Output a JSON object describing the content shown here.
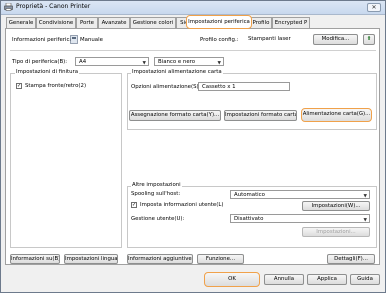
{
  "window": {
    "title": "Proprietà - Canon Printer",
    "close_glyph": "✕"
  },
  "tabs": [
    {
      "label": "Generale"
    },
    {
      "label": "Condivisione"
    },
    {
      "label": "Porte"
    },
    {
      "label": "Avanzate"
    },
    {
      "label": "Gestione colori"
    },
    {
      "label": "Sicurezza"
    },
    {
      "label": "Impostazioni periferica"
    },
    {
      "label": "Profilo"
    },
    {
      "label": "Encrypted P"
    }
  ],
  "device_info": {
    "label": "Informazioni periferica:",
    "value": "Manuale",
    "profile_label": "Profilo config.:",
    "profile_value": "Stampanti laser",
    "modify_button": "Modifica..."
  },
  "paper": {
    "type_label": "Tipo di periferica(B):",
    "size_value": "A4",
    "color_value": "Bianco e nero"
  },
  "finishing": {
    "title": "Impostazioni di finitura",
    "duplex_label": "Stampa fronte/retro(2)",
    "duplex_checked": true
  },
  "paper_source": {
    "title": "Impostazioni alimentazione carta",
    "options_label": "Opzioni alimentazione(S):",
    "options_value": "Cassetto x 1",
    "btn_assign": "Assegnazione formato carta(Y)...",
    "btn_format": "Impostazioni formato carta(K)...",
    "btn_feed": "Alimentazione carta(G)..."
  },
  "other": {
    "title": "Altre impostazioni",
    "spooling_label": "Spooling sull'host:",
    "spooling_value": "Automatico",
    "userinfo_label": "Imposta informazioni utente(L)",
    "userinfo_checked": true,
    "userinfo_button": "Impostazioni(W)...",
    "usermgmt_label": "Gestione utente(U):",
    "usermgmt_value": "Disattivato",
    "usermgmt_button": "Impostazioni..."
  },
  "bottom_buttons": {
    "info": "Informazioni su(B)",
    "language": "Impostazioni lingua...",
    "extra_info": "Informazioni aggiuntive(O)",
    "functions": "Funzione...",
    "details": "Dettagli(F)..."
  },
  "dialog_buttons": {
    "ok": "OK",
    "cancel": "Annulla",
    "apply": "Applica",
    "help": "Guida"
  }
}
